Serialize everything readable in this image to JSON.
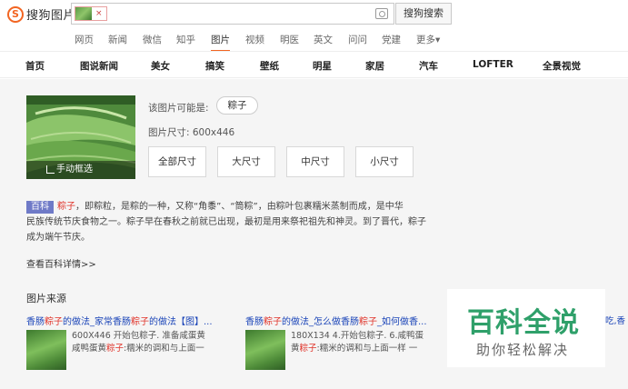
{
  "header": {
    "logo_mark": "S",
    "logo_text": "搜狗图片",
    "thumb_remove": "×",
    "search_button": "搜狗搜索"
  },
  "tabs": [
    {
      "label": "网页"
    },
    {
      "label": "新闻"
    },
    {
      "label": "微信"
    },
    {
      "label": "知乎"
    },
    {
      "label": "图片",
      "active": true
    },
    {
      "label": "视频"
    },
    {
      "label": "明医"
    },
    {
      "label": "英文"
    },
    {
      "label": "问问"
    },
    {
      "label": "党建"
    },
    {
      "label": "更多▾"
    }
  ],
  "categories": [
    "首页",
    "图说新闻",
    "美女",
    "搞笑",
    "壁纸",
    "明星",
    "家居",
    "汽车",
    "LOFTER",
    "全景视觉"
  ],
  "result": {
    "manual_crop": "手动框选",
    "maybe_label": "该图片可能是:",
    "maybe_tag": "粽子",
    "size_label": "图片尺寸: 600x446",
    "size_buttons": [
      "全部尺寸",
      "大尺寸",
      "中尺寸",
      "小尺寸"
    ]
  },
  "baike": {
    "badge": "百科",
    "keyword": "粽子",
    "text_line1": "，即粽粒，是粽的一种，又称“角黍”、“筒粽”，由粽叶包裹糯米蒸制而成，是中华",
    "text_line2": "民族传统节庆食物之一。粽子早在春秋之前就已出现，最初是用来祭祀祖先和神灵。到了晋代，粽子",
    "text_line3": "成为端午节庆。",
    "more": "查看百科详情>>"
  },
  "sources": {
    "title": "图片来源",
    "items": [
      {
        "t1": "香肠",
        "t2": "粽子",
        "t3": "的做法_家常香肠",
        "t4": "粽子",
        "t5": "的做法【图】...",
        "d1": "600X446 开始包粽子. 准备咸蛋黄",
        "d2": "咸鸭蛋黄",
        "d3": "粽子",
        "d4": ":糯米的调和与上面一"
      },
      {
        "t1": "香肠",
        "t2": "粽子",
        "t3": "的做法_怎么做香肠",
        "t4": "粽子",
        "t5": "_如何做香...",
        "d1": "180X134 4.开始包粽子. 6.咸鸭蛋",
        "d2": "黄",
        "d3": "粽子",
        "d4": ":糯米的调和与上面一样 一"
      }
    ]
  },
  "watermark": {
    "main": "百科全说",
    "sub": "助你轻松解决"
  },
  "right_strip": "吃,香"
}
